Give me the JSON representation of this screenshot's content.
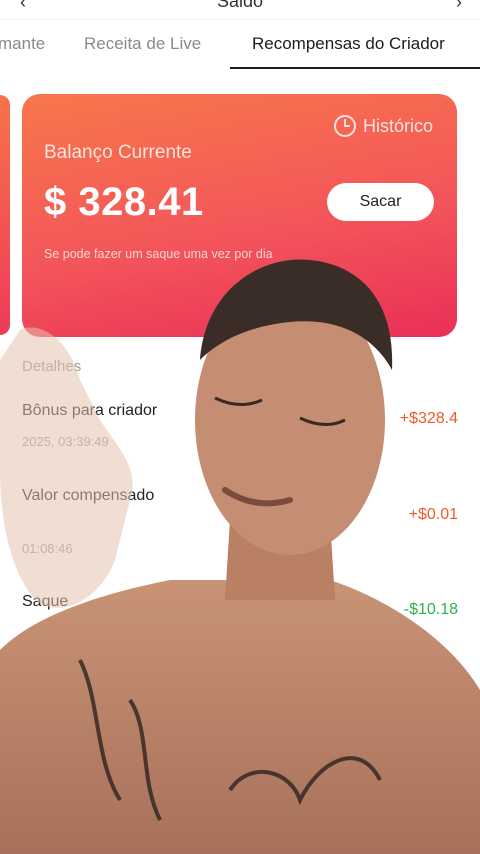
{
  "header": {
    "back_icon": "chevron-left-icon",
    "title": "Saldo",
    "more_icon": "more-icon"
  },
  "tabs": [
    {
      "label": "mante"
    },
    {
      "label": "Receita de Live"
    },
    {
      "label": "Recompensas do Criador",
      "active": true
    }
  ],
  "balance_card": {
    "history_label": "Histórico",
    "history_icon": "clock-icon",
    "label": "Balanço Currente",
    "amount": "$ 328.41",
    "withdraw_label": "Sacar",
    "note": "Se pode fazer um saque uma vez por dia",
    "gradient": [
      "#f8774a",
      "#ea2f57"
    ]
  },
  "details": {
    "label": "Detalhes",
    "rows": [
      {
        "title": "Bônus para criador",
        "time": "2025, 03:39:49",
        "amount": "+$328.4",
        "type": "credit"
      },
      {
        "title": "Valor compensado",
        "time": "01:08:46",
        "amount": "+$0.01",
        "type": "credit"
      },
      {
        "title": "Saque",
        "time": "",
        "amount": "-$10.18",
        "type": "debit"
      }
    ]
  },
  "colors": {
    "credit": "#ef5a2c",
    "debit": "#2bb24c"
  }
}
